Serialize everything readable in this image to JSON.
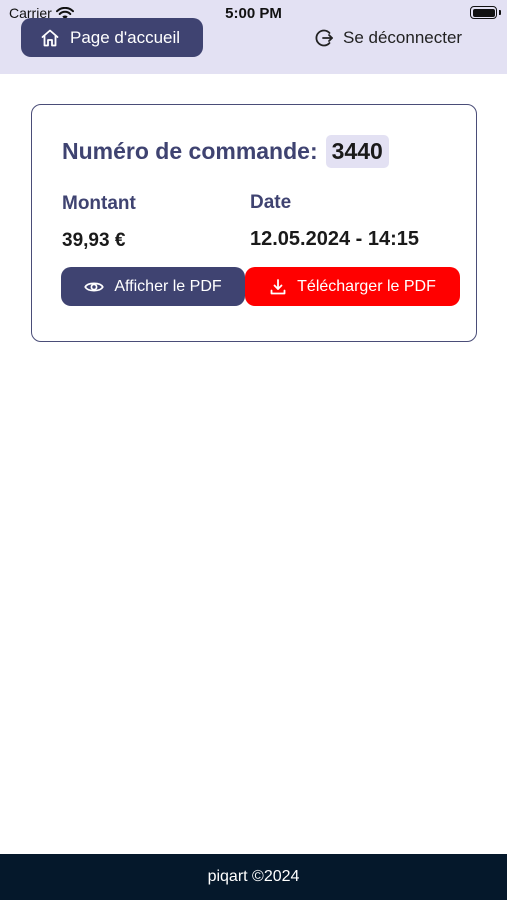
{
  "status_bar": {
    "carrier": "Carrier",
    "time": "5:00 PM"
  },
  "header": {
    "home_label": "Page d'accueil",
    "logout_label": "Se déconnecter"
  },
  "order": {
    "title_label": "Numéro de commande:",
    "number": "3440",
    "amount_label": "Montant",
    "amount_value": "39,93 €",
    "date_label": "Date",
    "date_value": "12.05.2024 - 14:15",
    "view_pdf_label": "Afficher le PDF",
    "download_pdf_label": "Télécharger le PDF"
  },
  "footer": {
    "text": "piqart ©2024"
  },
  "colors": {
    "header_bg": "#e3e1f3",
    "primary": "#3f4371",
    "danger": "#ff0000",
    "footer_bg": "#05182b"
  },
  "icons": {
    "home": "home-icon",
    "logout": "logout-icon",
    "view": "eye-icon",
    "download": "download-icon",
    "wifi": "wifi-icon",
    "battery": "battery-icon"
  }
}
